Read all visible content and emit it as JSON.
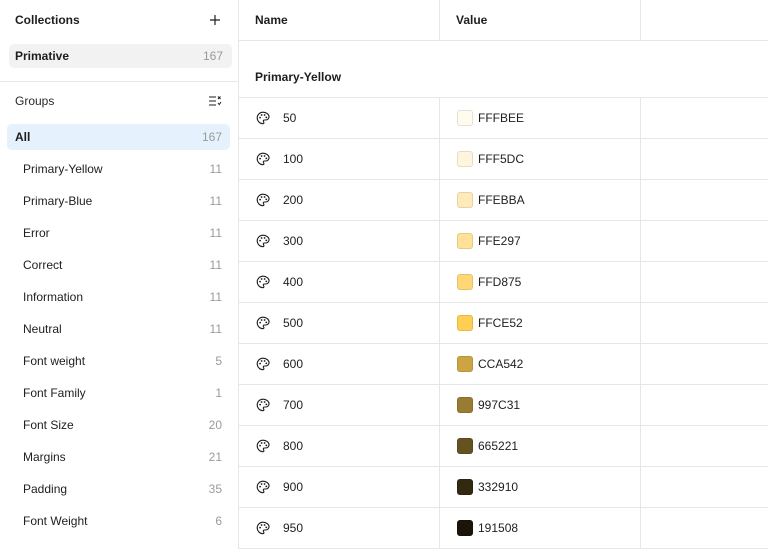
{
  "collections": {
    "title": "Collections",
    "items": [
      {
        "label": "Primative",
        "count": "167"
      }
    ]
  },
  "groups": {
    "title": "Groups",
    "items": [
      {
        "label": "All",
        "count": "167"
      },
      {
        "label": "Primary-Yellow",
        "count": "11"
      },
      {
        "label": "Primary-Blue",
        "count": "11"
      },
      {
        "label": "Error",
        "count": "11"
      },
      {
        "label": "Correct",
        "count": "11"
      },
      {
        "label": "Information",
        "count": "11"
      },
      {
        "label": "Neutral",
        "count": "11"
      },
      {
        "label": "Font weight",
        "count": "5"
      },
      {
        "label": "Font Family",
        "count": "1"
      },
      {
        "label": "Font Size",
        "count": "20"
      },
      {
        "label": "Margins",
        "count": "21"
      },
      {
        "label": "Padding",
        "count": "35"
      },
      {
        "label": "Font Weight",
        "count": "6"
      }
    ]
  },
  "table": {
    "headers": {
      "name": "Name",
      "value": "Value"
    },
    "group_heading": "Primary-Yellow",
    "rows": [
      {
        "name": "50",
        "value": "FFFBEE",
        "color": "#FFFBEE"
      },
      {
        "name": "100",
        "value": "FFF5DC",
        "color": "#FFF5DC"
      },
      {
        "name": "200",
        "value": "FFEBBA",
        "color": "#FFEBBA"
      },
      {
        "name": "300",
        "value": "FFE297",
        "color": "#FFE297"
      },
      {
        "name": "400",
        "value": "FFD875",
        "color": "#FFD875"
      },
      {
        "name": "500",
        "value": "FFCE52",
        "color": "#FFCE52"
      },
      {
        "name": "600",
        "value": "CCA542",
        "color": "#CCA542"
      },
      {
        "name": "700",
        "value": "997C31",
        "color": "#997C31"
      },
      {
        "name": "800",
        "value": "665221",
        "color": "#665221"
      },
      {
        "name": "900",
        "value": "332910",
        "color": "#332910"
      },
      {
        "name": "950",
        "value": "191508",
        "color": "#191508"
      }
    ]
  },
  "colors": {
    "selected_bg": "#E5F1FD",
    "collection_bg": "#F2F2F2",
    "border": "#E6E6E6",
    "muted_text": "#9A9A9A"
  }
}
